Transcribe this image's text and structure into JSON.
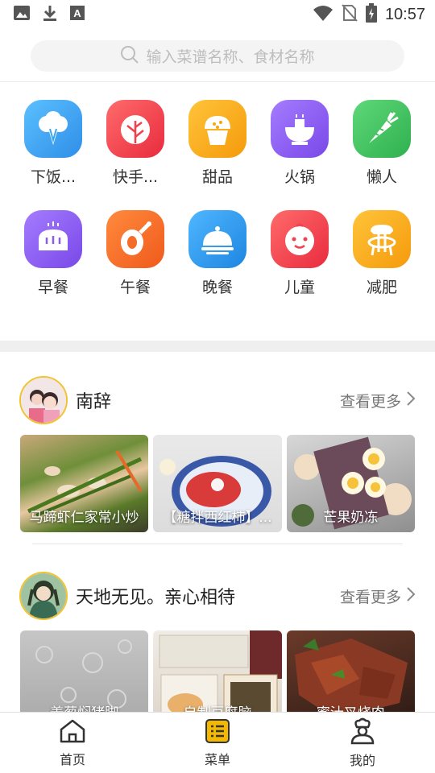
{
  "status_bar": {
    "time": "10:57"
  },
  "search": {
    "placeholder": "输入菜谱名称、食材名称"
  },
  "categories": [
    {
      "label": "下饭...",
      "icon": "broccoli-icon",
      "color": "#3aa6ee"
    },
    {
      "label": "快手...",
      "icon": "cabbage-icon",
      "color": "#f2414e"
    },
    {
      "label": "甜品",
      "icon": "cupcake-icon",
      "color": "#f7a614"
    },
    {
      "label": "火锅",
      "icon": "hotpot-icon",
      "color": "#8b5cf0"
    },
    {
      "label": "懒人",
      "icon": "carrot-icon",
      "color": "#3cbf5a"
    },
    {
      "label": "早餐",
      "icon": "bread-icon",
      "color": "#8b5cf0"
    },
    {
      "label": "午餐",
      "icon": "ham-icon",
      "color": "#f56b28"
    },
    {
      "label": "晚餐",
      "icon": "cloche-icon",
      "color": "#2f9ae8"
    },
    {
      "label": "儿童",
      "icon": "baby-face-icon",
      "color": "#f2414e"
    },
    {
      "label": "减肥",
      "icon": "scale-icon",
      "color": "#f7a614"
    }
  ],
  "sections": [
    {
      "user": "南辞",
      "more": "查看更多",
      "cards": [
        {
          "title": "马蹄虾仁家常小炒"
        },
        {
          "title": "【糖拌西红柿】..."
        },
        {
          "title": "芒果奶冻"
        }
      ]
    },
    {
      "user": "天地无见。亲心相待",
      "more": "查看更多",
      "cards": [
        {
          "title": "姜葱焖猪脚"
        },
        {
          "title": "自制豆腐脑"
        },
        {
          "title": "蜜汁叉烧肉"
        }
      ]
    }
  ],
  "tabbar": [
    {
      "label": "首页",
      "icon": "home-icon"
    },
    {
      "label": "菜单",
      "icon": "menu-icon",
      "color": "#f5b800"
    },
    {
      "label": "我的",
      "icon": "chef-profile-icon"
    }
  ]
}
